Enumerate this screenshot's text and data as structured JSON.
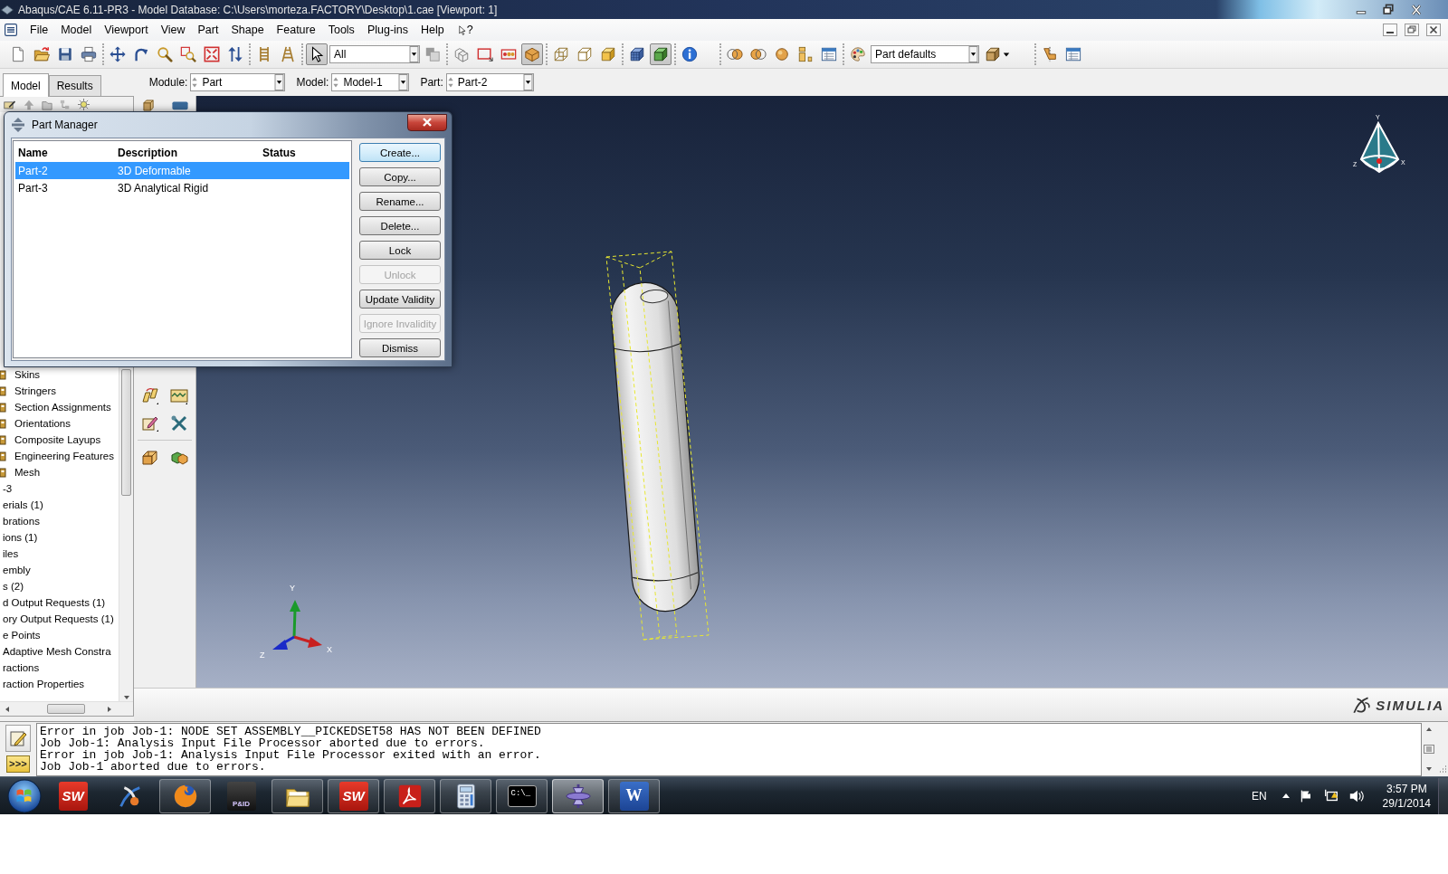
{
  "window": {
    "title": "Abaqus/CAE 6.11-PR3 - Model Database: C:\\Users\\morteza.FACTORY\\Desktop\\1.cae [Viewport: 1]"
  },
  "menu": [
    {
      "label": "File",
      "kind": "menu"
    },
    {
      "label": "Model",
      "kind": "menu"
    },
    {
      "label": "Viewport",
      "kind": "menu"
    },
    {
      "label": "View",
      "kind": "menu"
    },
    {
      "label": "Part",
      "kind": "menu"
    },
    {
      "label": "Shape",
      "kind": "menu"
    },
    {
      "label": "Feature",
      "kind": "menu"
    },
    {
      "label": "Tools",
      "kind": "menu"
    },
    {
      "label": "Plug-ins",
      "kind": "menu"
    },
    {
      "label": "Help",
      "kind": "menu"
    },
    {
      "label": "?",
      "kind": "help"
    }
  ],
  "toolbar": {
    "groups": [
      {
        "items": [
          {
            "kind": "button",
            "pressed": false
          },
          {
            "kind": "button",
            "pressed": false
          },
          {
            "kind": "button",
            "pressed": false
          },
          {
            "kind": "button",
            "pressed": false
          }
        ]
      },
      {
        "items": [
          {
            "kind": "button",
            "pressed": false
          },
          {
            "kind": "button",
            "pressed": false
          },
          {
            "kind": "button",
            "pressed": false
          },
          {
            "kind": "button",
            "pressed": false
          },
          {
            "kind": "button",
            "pressed": false
          },
          {
            "kind": "button",
            "pressed": false
          }
        ]
      },
      {
        "items": [
          {
            "kind": "button",
            "pressed": false
          },
          {
            "kind": "button",
            "pressed": false
          }
        ]
      },
      {
        "items": [
          {
            "kind": "button",
            "pressed": true
          },
          {
            "kind": "dropdown",
            "value": "All"
          },
          {
            "kind": "button",
            "pressed": false
          }
        ]
      },
      {
        "items": [
          {
            "kind": "button",
            "pressed": false
          },
          {
            "kind": "button",
            "pressed": false
          },
          {
            "kind": "button",
            "pressed": false
          },
          {
            "kind": "button",
            "pressed": true
          }
        ]
      },
      {
        "items": [
          {
            "kind": "button",
            "pressed": false
          },
          {
            "kind": "button",
            "pressed": false
          },
          {
            "kind": "button",
            "pressed": false
          }
        ]
      },
      {
        "items": [
          {
            "kind": "button",
            "pressed": false
          },
          {
            "kind": "button",
            "pressed": true
          }
        ]
      },
      {
        "items": [
          {
            "kind": "button",
            "pressed": false
          }
        ]
      },
      {
        "items": [
          {
            "kind": "button",
            "pressed": false
          },
          {
            "kind": "button",
            "pressed": false
          },
          {
            "kind": "button",
            "pressed": false
          },
          {
            "kind": "button",
            "pressed": false
          },
          {
            "kind": "button",
            "pressed": false
          }
        ]
      },
      {
        "items": [
          {
            "kind": "button",
            "pressed": false
          },
          {
            "kind": "dropdown",
            "value": "Part defaults"
          },
          {
            "kind": "menu_button",
            "pressed": false
          }
        ]
      },
      {
        "items": [
          {
            "kind": "button",
            "pressed": false
          },
          {
            "kind": "button",
            "pressed": false
          }
        ]
      }
    ]
  },
  "context_bar": {
    "tabs": [
      {
        "label": "Model",
        "selected": true
      },
      {
        "label": "Results",
        "selected": false
      }
    ],
    "fields": [
      {
        "label": "Module:",
        "value": "Part"
      },
      {
        "label": "Model:",
        "value": "Model-1"
      },
      {
        "label": "Part:",
        "value": "Part-2"
      }
    ]
  },
  "model_tree": {
    "items": [
      {
        "children": [
          {
            "label": "Skins"
          },
          {
            "label": "Stringers"
          },
          {
            "label": "Section Assignments"
          },
          {
            "label": "Orientations"
          },
          {
            "label": "Composite Layups"
          },
          {
            "label": "Engineering Features"
          },
          {
            "label": "Mesh"
          }
        ]
      },
      {
        "label": "-3"
      },
      {
        "label": "erials (1)"
      },
      {
        "label": "brations"
      },
      {
        "label": "ions (1)"
      },
      {
        "label": "iles"
      },
      {
        "label": "embly"
      },
      {
        "label": "s (2)"
      },
      {
        "label": "d Output Requests (1)"
      },
      {
        "label": "ory Output Requests (1)"
      },
      {
        "label": "e Points"
      },
      {
        "label": "Adaptive Mesh Constra"
      },
      {
        "label": "ractions"
      },
      {
        "label": "raction Properties"
      }
    ]
  },
  "part_manager": {
    "title": "Part Manager",
    "columns": [
      "Name",
      "Description",
      "Status"
    ],
    "rows": [
      {
        "cells": [
          "Part-2",
          "3D Deformable"
        ],
        "selected": true
      },
      {
        "cells": [
          "Part-3",
          "3D Analytical Rigid"
        ],
        "selected": false
      }
    ],
    "buttons": [
      {
        "label": "Create...",
        "default": true,
        "disabled": false
      },
      {
        "label": "Copy...",
        "default": false,
        "disabled": false
      },
      {
        "label": "Rename...",
        "default": false,
        "disabled": false
      },
      {
        "label": "Delete...",
        "default": false,
        "disabled": false
      },
      {
        "label": "Lock",
        "default": false,
        "disabled": false
      },
      {
        "label": "Unlock",
        "default": false,
        "disabled": true
      },
      {
        "label": "Update Validity",
        "default": false,
        "disabled": false
      },
      {
        "label": "Ignore Invalidity",
        "default": false,
        "disabled": true
      },
      {
        "label": "Dismiss",
        "default": false,
        "disabled": false
      }
    ]
  },
  "viewport": {
    "triad_labels": [
      "Y",
      "X",
      "Z"
    ],
    "compass_labels": [
      "Y",
      "Z",
      "X"
    ],
    "logo": "SIMULIA"
  },
  "message_area": {
    "command_prompt": ">>>",
    "lines": [
      "Error in job Job-1: NODE SET ASSEMBLY__PICKEDSET58 HAS NOT BEEN DEFINED",
      "Job Job-1: Analysis Input File Processor aborted due to errors.",
      "Error in job Job-1: Analysis Input File Processor exited with an error.",
      "Job Job-1 aborted due to errors."
    ]
  },
  "taskbar": {
    "apps": [
      {
        "kind": "solidworks",
        "mark": "SW",
        "running": false,
        "selected": false
      },
      {
        "kind": "swirl",
        "running": false,
        "selected": false
      },
      {
        "kind": "browser",
        "running": true,
        "selected": false
      },
      {
        "kind": "pid",
        "mark": "P&ID",
        "running": false,
        "selected": false
      },
      {
        "kind": "folder",
        "running": true,
        "selected": false
      },
      {
        "kind": "solidworks",
        "mark": "SW",
        "running": true,
        "selected": false
      },
      {
        "kind": "pdf",
        "running": true,
        "selected": false
      },
      {
        "kind": "calculator",
        "running": true,
        "selected": false
      },
      {
        "kind": "console",
        "mark": "C:\\_",
        "running": true,
        "selected": false
      },
      {
        "kind": "spindle",
        "running": true,
        "selected": true
      },
      {
        "kind": "word",
        "mark": "W",
        "running": true,
        "selected": false
      }
    ],
    "language": "EN",
    "time": "3:57 PM",
    "date": "29/1/2014"
  }
}
